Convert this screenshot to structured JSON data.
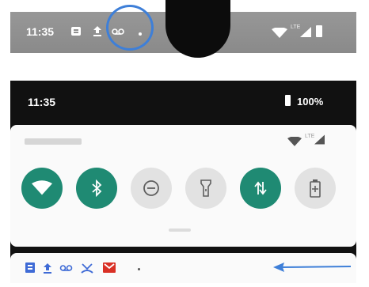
{
  "collapsed_bar": {
    "time": "11:35",
    "notification_icons": [
      "message-icon",
      "upload-icon",
      "voicemail-icon",
      "more-dot"
    ],
    "status_icons": [
      "wifi-icon",
      "lte-signal-icon",
      "battery-icon"
    ],
    "network_label": "LTE"
  },
  "expanded_shade": {
    "time": "11:35",
    "battery_percent": "100%",
    "network_label": "LTE",
    "quick_tiles": [
      {
        "name": "wifi",
        "state": "on"
      },
      {
        "name": "bluetooth",
        "state": "on"
      },
      {
        "name": "do-not-disturb",
        "state": "off"
      },
      {
        "name": "flashlight",
        "state": "off"
      },
      {
        "name": "mobile-data",
        "state": "on"
      },
      {
        "name": "battery-saver",
        "state": "off"
      }
    ],
    "notification_icons": [
      "message-icon",
      "upload-icon",
      "voicemail-icon",
      "missed-call-icon",
      "gmail-icon",
      "more-dot"
    ]
  },
  "colors": {
    "accent_tile": "#1f8a73",
    "highlight_circle": "#3e7fd8",
    "arrow": "#3e7fd8"
  }
}
